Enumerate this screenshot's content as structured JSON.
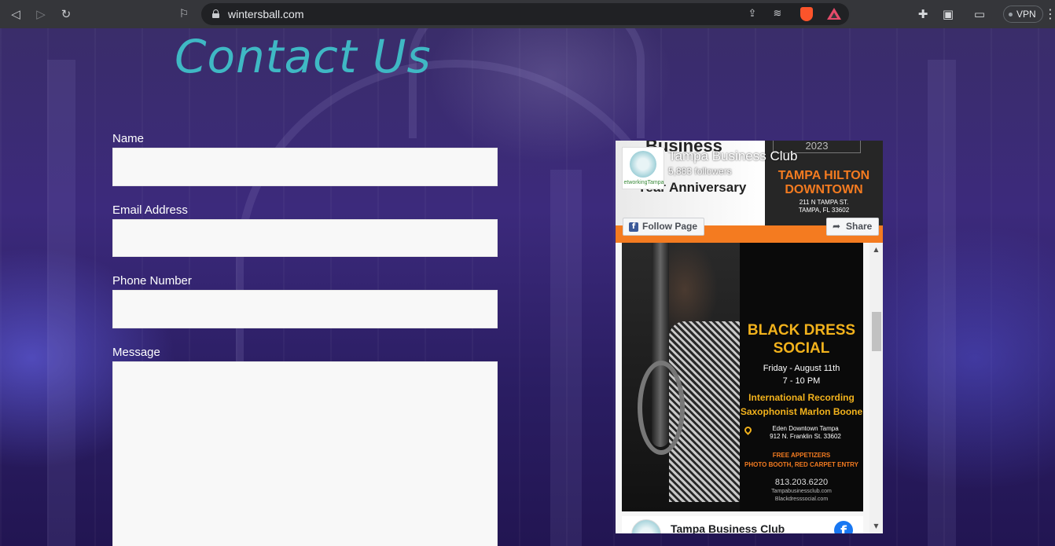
{
  "browser": {
    "url": "wintersball.com",
    "vpn_label": "VPN",
    "icons": {
      "back": "back-arrow-icon",
      "forward": "forward-arrow-icon",
      "reload": "reload-icon",
      "bookmark": "bookmark-icon"
    }
  },
  "page": {
    "title": "Contact Us",
    "title_color": "#3fb8c4"
  },
  "form": {
    "name_label": "Name",
    "email_label": "Email Address",
    "phone_label": "Phone Number",
    "message_label": "Message",
    "name_value": "",
    "email_value": "",
    "phone_value": "",
    "message_value": ""
  },
  "facebook": {
    "page_name": "Tampa Business Club",
    "followers": "5,883 followers",
    "follow_label": "Follow Page",
    "share_label": "Share",
    "avatar_brand": "etworkingTampa",
    "cover": {
      "line1": "Business",
      "line2": "Year Anniversary",
      "year": "2023",
      "venue_line1": "TAMPA HILTON",
      "venue_line2": "DOWNTOWN",
      "address_line1": "211 N TAMPA ST.",
      "address_line2": "TAMPA, FL 33602"
    },
    "flyer": {
      "heading_line1": "BLACK DRESS",
      "heading_line2": "SOCIAL",
      "date": "Friday - August 11th",
      "time": "7 - 10 PM",
      "artist_line1": "International Recording",
      "artist_line2": "Saxophonist Marlon Boone",
      "venue_line1": "Eden Downtown Tampa",
      "venue_line2": "912 N. Franklin St. 33602",
      "perks_line1": "FREE APPETIZERS",
      "perks_line2": "PHOTO BOOTH, RED CARPET ENTRY",
      "phone": "813.203.6220",
      "site1": "Tampabusinessclub.com",
      "site2": "Blackdresssocial.com"
    },
    "post_name": "Tampa Business Club",
    "brand_color": "#1877f2",
    "accent_color": "#f47b20"
  }
}
